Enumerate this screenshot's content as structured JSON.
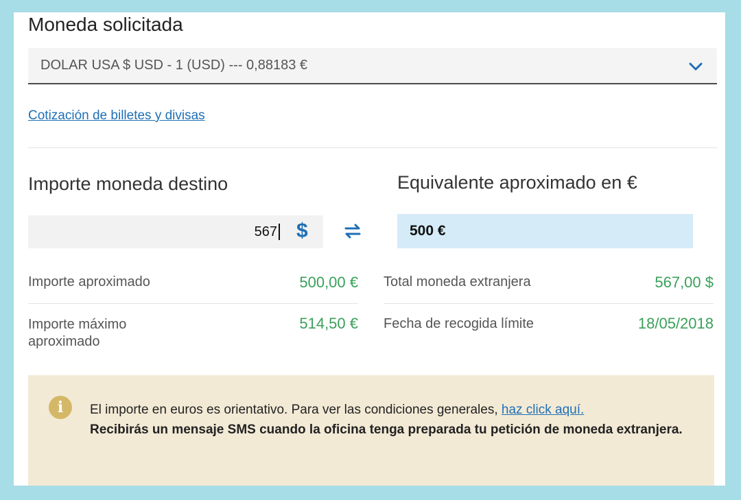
{
  "form": {
    "title": "Moneda solicitada",
    "currency_select": {
      "selected": "DOLAR USA $ USD - 1 (USD) --- 0,88183 €"
    },
    "quotes_link": "Cotización de billetes y divisas"
  },
  "amount": {
    "heading": "Importe moneda destino",
    "value": "567",
    "currency_symbol": "$"
  },
  "equivalent": {
    "heading": "Equivalente aproximado en €",
    "value": "500 €"
  },
  "summary": {
    "left": [
      {
        "label": "Importe aproximado",
        "value": "500,00 €"
      },
      {
        "label": "Importe máximo aproximado",
        "value": "514,50 €"
      }
    ],
    "right": [
      {
        "label": "Total moneda extranjera",
        "value": "567,00 $"
      },
      {
        "label": "Fecha de recogida límite",
        "value": "18/05/2018"
      }
    ]
  },
  "notice": {
    "text": "El importe en euros es orientativo. Para ver las condiciones generales,",
    "link": "haz click aquí.",
    "bold_text": "Recibirás un mensaje SMS cuando la oficina tenga preparada tu petición de moneda extranjera."
  },
  "colors": {
    "accent_blue": "#1f6fb5",
    "value_green": "#3aa05a",
    "notice_bg": "#f3ead6",
    "equiv_bg": "#d5ebf8",
    "frame": "#a7dde6"
  },
  "icons": {
    "select": "chevron-down-icon",
    "swap": "swap-arrows-icon",
    "notice": "info-icon"
  }
}
